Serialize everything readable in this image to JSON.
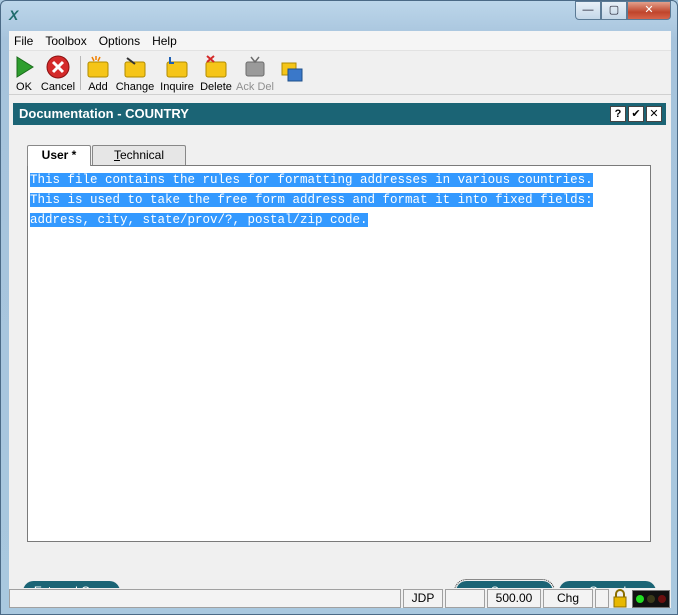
{
  "window": {
    "buttons": {
      "minimize": "—",
      "maximize": "▢",
      "close": "✕"
    }
  },
  "menu": [
    "File",
    "Toolbox",
    "Options",
    "Help"
  ],
  "toolbar": {
    "ok": "OK",
    "cancel": "Cancel",
    "add": "Add",
    "change": "Change",
    "inquire": "Inquire",
    "delete": "Delete",
    "ack_del": "Ack Del"
  },
  "panel": {
    "title": "Documentation - COUNTRY",
    "buttons": {
      "help": "?",
      "check": "✔",
      "close": "✕"
    },
    "tabs": {
      "user": "User *",
      "technical_prefix": "",
      "technical_underlined": "T",
      "technical_rest": "echnical"
    },
    "document_lines": [
      "This file contains the rules for formatting addresses in various countries.",
      "This is used to take the free form address and format it into fixed fields:",
      "address, city, state/prov/?, postal/zip code."
    ],
    "buttons_bottom": {
      "external_copy": "External Copy",
      "save_underlined": "S",
      "save_rest": "ave",
      "cancel_underlined": "C",
      "cancel_rest": "ancel"
    }
  },
  "status": {
    "user": "JDP",
    "value": "500.00",
    "mode": "Chg"
  },
  "colors": {
    "accent": "#1b6475",
    "selection": "#3399ff"
  }
}
